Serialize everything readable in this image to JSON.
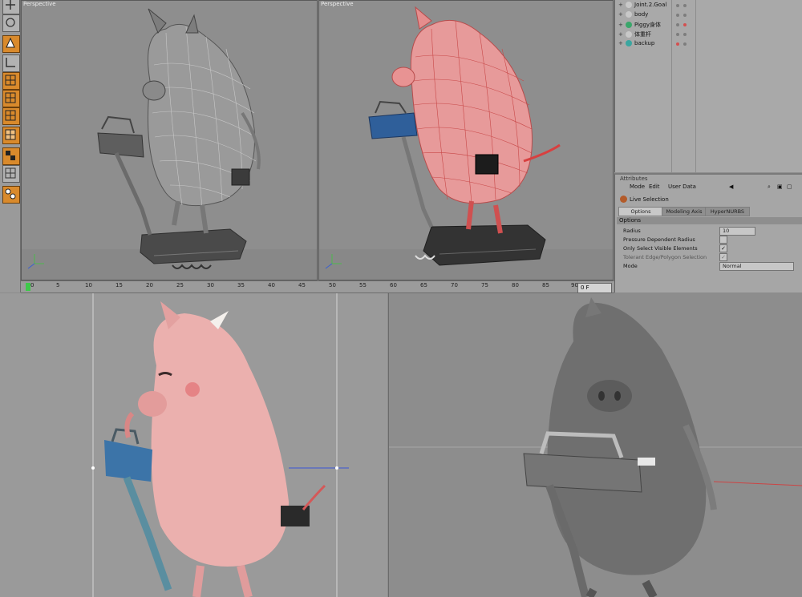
{
  "viewports": {
    "top_left_label": "Perspective",
    "top_right_label": "Perspective"
  },
  "tools": [
    "move-tool",
    "rotate-tool",
    "axis-tool",
    "polygon-grid-tool",
    "grid-tool",
    "grid-tool",
    "grid-tool",
    "checker-tool",
    "grid-tool",
    "node-tool"
  ],
  "timeline": {
    "ticks": [
      "0",
      "5",
      "10",
      "15",
      "20",
      "25",
      "30",
      "35",
      "40",
      "45",
      "50",
      "55",
      "60",
      "65",
      "70",
      "75",
      "80",
      "85",
      "90"
    ],
    "current_frame": "0 F"
  },
  "object_manager": {
    "items": [
      {
        "label": "Joint.2.Goal",
        "icon_color": "#c8c8c8"
      },
      {
        "label": "body",
        "icon_color": "#c8c8c8"
      },
      {
        "label": "Piggy身体",
        "icon_color": "#3aa66a"
      },
      {
        "label": "体重杆",
        "icon_color": "#c8c8c8"
      },
      {
        "label": "backup",
        "icon_color": "#3aa6a0"
      }
    ]
  },
  "attributes": {
    "title": "Attributes",
    "menu": [
      "Mode",
      "Edit",
      "User Data"
    ],
    "tool_name": "Live Selection",
    "tabs": [
      "Options",
      "Modeling Axis",
      "HyperNURBS"
    ],
    "section": "Options",
    "props": {
      "radius_label": "Radius",
      "radius_value": "10",
      "pressure_label": "Pressure Dependent Radius",
      "visible_label": "Only Select Visible Elements",
      "tolerant_label": "Tolerant Edge/Polygon Selection",
      "mode_label": "Mode",
      "mode_value": "Normal"
    },
    "check_mark": "✓"
  },
  "colors": {
    "accent": "#d98a2c",
    "pig_pink": "#e7a2a2",
    "selection_red": "#e06a6a",
    "grey_model": "#6d6d6d"
  }
}
